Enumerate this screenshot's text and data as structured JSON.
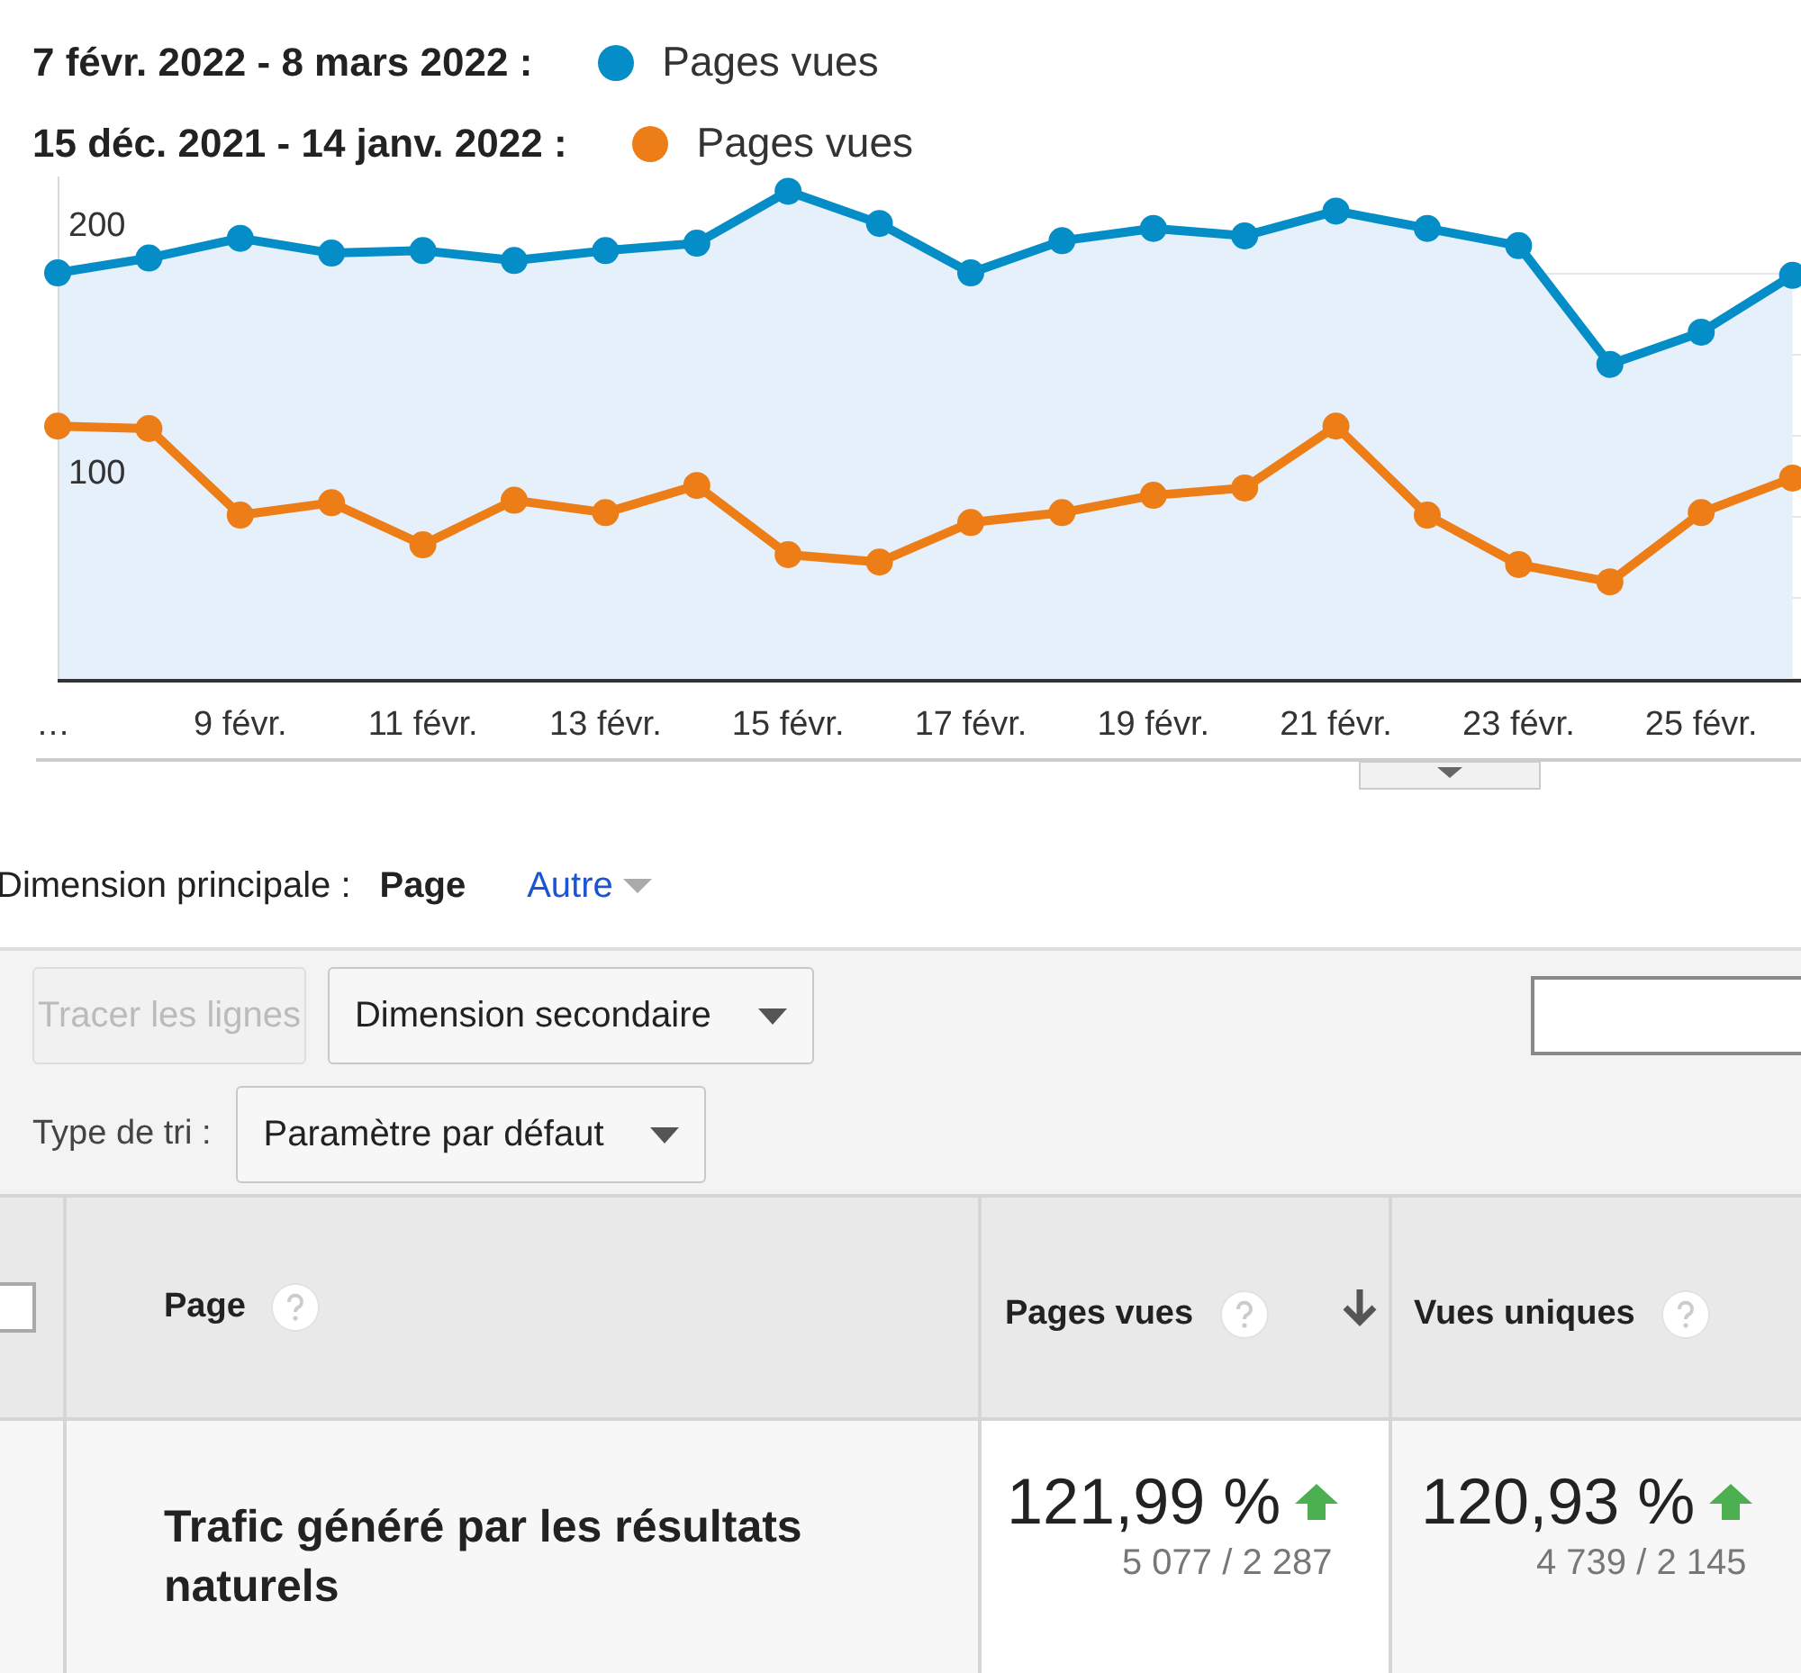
{
  "legend": [
    {
      "range": "7 févr. 2022 - 8 mars 2022 :"
    },
    {
      "range": "15 déc. 2021 - 14 janv. 2022 :"
    }
  ],
  "chart_data": {
    "type": "line",
    "categories": [
      "…",
      null,
      "9 févr.",
      null,
      "11 févr.",
      null,
      "13 févr.",
      null,
      "15 févr.",
      null,
      "17 févr.",
      null,
      "19 févr.",
      null,
      "21 févr.",
      null,
      "23 févr.",
      null,
      "25 févr.",
      null
    ],
    "ylim": [
      15,
      219
    ],
    "yticks": [
      100,
      200
    ],
    "series": [
      {
        "name": "Pages vues",
        "color": "#058dc7",
        "marker": "circle",
        "values": [
          180,
          186,
          194,
          188,
          189,
          185,
          189,
          192,
          213,
          200,
          180,
          193,
          198,
          195,
          205,
          198,
          191,
          143,
          156,
          179
        ]
      },
      {
        "name": "Pages vues",
        "color": "#ed7e17",
        "marker": "circle",
        "values": [
          118,
          117,
          82,
          87,
          70,
          88,
          83,
          94,
          66,
          63,
          79,
          83,
          90,
          93,
          118,
          82,
          62,
          55,
          83,
          97
        ]
      }
    ]
  },
  "primary_dimension": {
    "label": "Dimension principale :",
    "options": [
      {
        "label": "Page",
        "selected": true,
        "dropdown": false
      },
      {
        "label": "Autre",
        "selected": false,
        "dropdown": true
      }
    ]
  },
  "toolbar": {
    "buttons": [
      {
        "label": "Tracer les lignes",
        "kind": "plain",
        "disabled": true
      },
      {
        "label": "Dimension secondaire",
        "kind": "dropdown",
        "disabled": false
      }
    ],
    "sort_label": "Type de tri :",
    "sort_value": "Paramètre par défaut"
  },
  "table": {
    "select_all_checked": false,
    "columns": [
      {
        "label": "Page",
        "sorted": false
      },
      {
        "label": "Pages vues",
        "sorted": true
      },
      {
        "label": "Vues uniques",
        "sorted": false
      }
    ],
    "rows": [
      {
        "cells": [
          {
            "kind": "text",
            "text": "Trafic généré par les résultats naturels"
          },
          {
            "kind": "up",
            "change": "121,99 %",
            "detail": "5 077 / 2 287"
          },
          {
            "kind": "up",
            "change": "120,93 %",
            "detail": "4 739 / 2 145"
          }
        ]
      }
    ]
  }
}
